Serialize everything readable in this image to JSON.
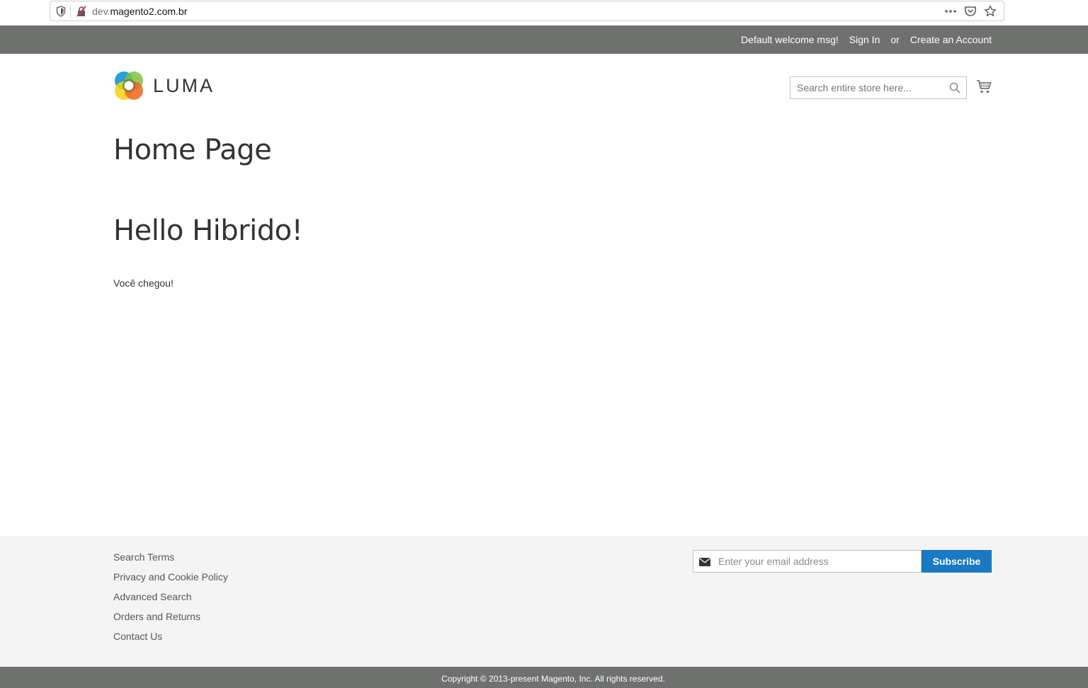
{
  "browser": {
    "url_subdomain": "dev.",
    "url_domain": "magento2.com.br"
  },
  "header": {
    "welcome": "Default welcome msg!",
    "sign_in": "Sign In",
    "or": "or",
    "create_account": "Create an Account"
  },
  "logo": {
    "text": "LUMA"
  },
  "search": {
    "placeholder": "Search entire store here..."
  },
  "main": {
    "page_title": "Home Page",
    "heading": "Hello Hibrido!",
    "paragraph": "Você chegou!"
  },
  "footer": {
    "links": [
      "Search Terms",
      "Privacy and Cookie Policy",
      "Advanced Search",
      "Orders and Returns",
      "Contact Us"
    ],
    "newsletter_placeholder": "Enter your email address",
    "subscribe_label": "Subscribe",
    "copyright": "Copyright © 2013-present Magento, Inc. All rights reserved."
  },
  "colors": {
    "header_bg": "#6e716e",
    "accent_button": "#1979c3",
    "footer_bg": "#f4f4f4"
  }
}
